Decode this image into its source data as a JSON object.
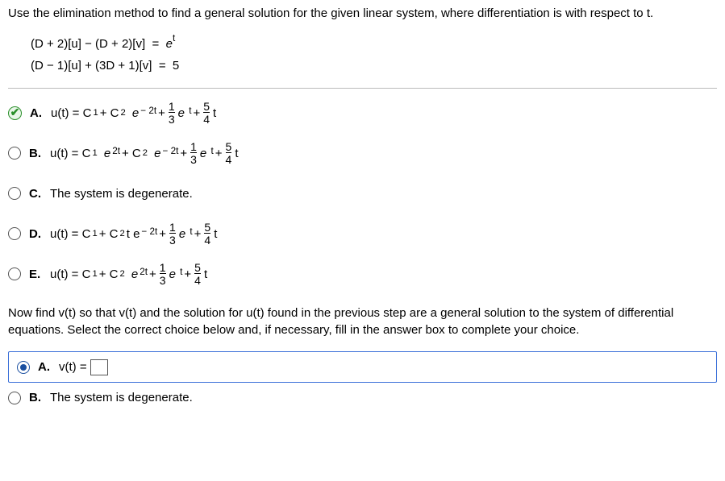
{
  "intro": "Use the elimination method to find a general solution for the given linear system, where differentiation is with respect to t.",
  "eq1_lhs": "(D + 2)[u] − (D + 2)[v]",
  "eq1_eq": "=",
  "eq1_rhs_e": "e",
  "eq1_rhs_t": "t",
  "eq2_lhs": "(D − 1)[u] + (3D + 1)[v]",
  "eq2_eq": "=",
  "eq2_rhs": "5",
  "labels": {
    "A": "A.",
    "B": "B.",
    "C": "C.",
    "D": "D.",
    "E": "E."
  },
  "optC_text": "The system is degenerate.",
  "ut_eq": "u(t) = C",
  "c1sub": "1",
  "c2sub": "2",
  "e": "e",
  "plus": " + ",
  "plusC2": " + C",
  "t": "t",
  "te": "t e",
  "exp_neg2t": "− 2t",
  "exp_2t": "2t",
  "frac13_n": "1",
  "frac13_d": "3",
  "frac54_n": "5",
  "frac54_d": "4",
  "et_e": "e",
  "et_t": " t",
  "part2_text": "Now find v(t) so that v(t) and the solution for u(t) found in the previous step are a general solution to the system of differential equations. Select the correct choice below and, if necessary, fill in the answer box to complete your choice.",
  "vA_label": "A.",
  "vA_text": "v(t) =",
  "vB_label": "B.",
  "vB_text": "The system is degenerate."
}
